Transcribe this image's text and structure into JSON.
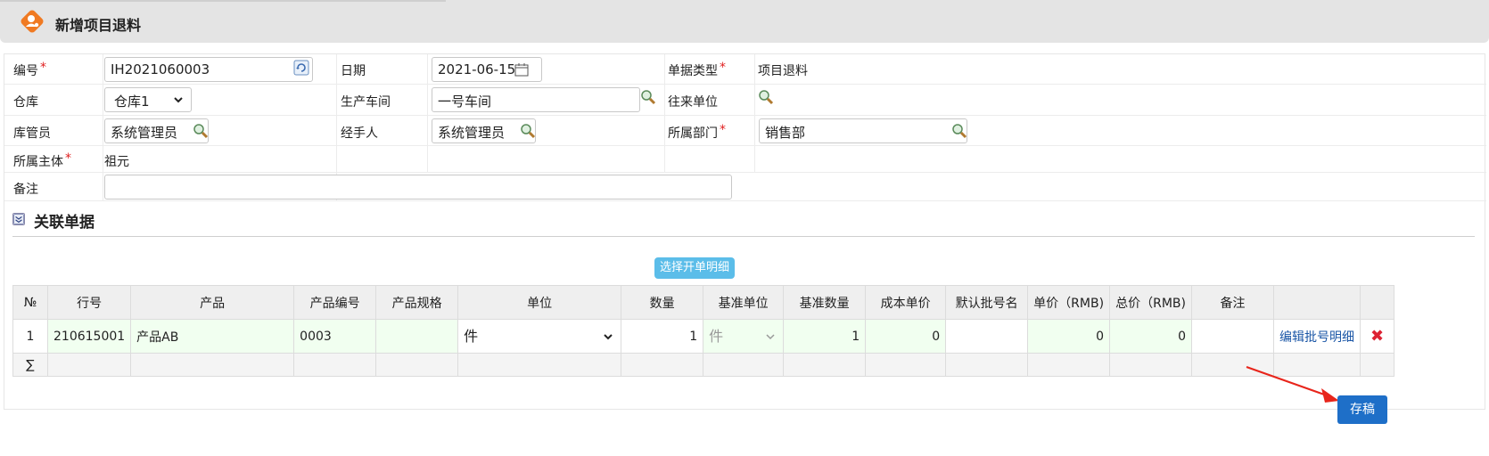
{
  "window": {
    "title": "新增项目退料"
  },
  "form": {
    "number_label": "编号",
    "number_value": "IH2021060003",
    "date_label": "日期",
    "date_value": "2021-06-15",
    "doc_type_label": "单据类型",
    "doc_type_value": "项目退料",
    "warehouse_label": "仓库",
    "warehouse_value": "仓库1",
    "workshop_label": "生产车间",
    "workshop_value": "一号车间",
    "partner_label": "往来单位",
    "keeper_label": "库管员",
    "keeper_value": "系统管理员",
    "handler_label": "经手人",
    "handler_value": "系统管理员",
    "dept_label": "所属部门",
    "dept_value": "销售部",
    "entity_label": "所属主体",
    "entity_value": "祖元",
    "remark_label": "备注",
    "remark_value": "",
    "required_mark": "*"
  },
  "section": {
    "title": "关联单据",
    "select_button": "选择开单明细"
  },
  "table": {
    "headers": [
      "№",
      "行号",
      "产品",
      "产品编号",
      "产品规格",
      "单位",
      "数量",
      "基准单位",
      "基准数量",
      "成本单价",
      "默认批号名",
      "单价（RMB)",
      "总价（RMB)",
      "备注",
      "",
      ""
    ],
    "rows": [
      {
        "no": "1",
        "line": "210615001",
        "product": "产品AB",
        "code": "0003",
        "spec": "",
        "unit": "件",
        "qty": "1",
        "base_unit": "件",
        "base_qty": "1",
        "cost": "0",
        "batch": "",
        "price": "0",
        "total": "0",
        "remark": "",
        "edit_link": "编辑批号明细",
        "delete": "✖"
      }
    ],
    "sum_symbol": "∑"
  },
  "actions": {
    "save": "存稿"
  },
  "colors": {
    "accent": "#1e6fc8",
    "required": "#e02020",
    "button": "#5bbde9",
    "logo": "#f07a22"
  }
}
